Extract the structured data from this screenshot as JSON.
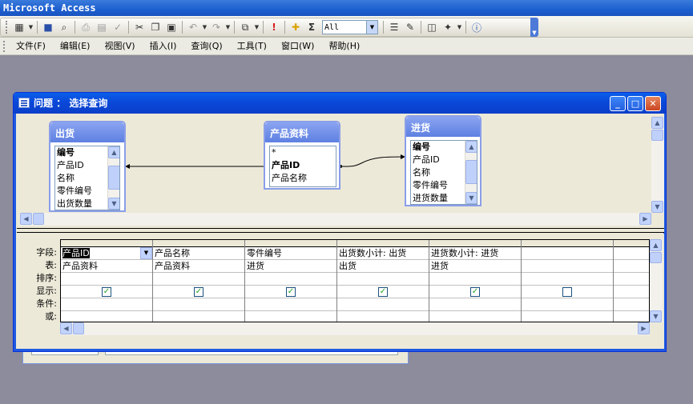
{
  "app": {
    "title": "Microsoft Access"
  },
  "toolbar": {
    "filter_value": "All",
    "icons": [
      "view-icon",
      "save-icon",
      "search-icon",
      "print-icon",
      "print-preview-icon",
      "spellcheck-icon",
      "cut-icon",
      "copy-icon",
      "paste-icon",
      "undo-icon",
      "redo-icon",
      "query-type-icon",
      "run-icon",
      "show-table-icon",
      "totals-icon",
      "properties-icon",
      "build-icon",
      "database-window-icon",
      "new-object-icon",
      "help-icon"
    ]
  },
  "menu": {
    "items": [
      "文件(F)",
      "编辑(E)",
      "视图(V)",
      "插入(I)",
      "查询(Q)",
      "工具(T)",
      "窗口(W)",
      "帮助(H)"
    ]
  },
  "query_window": {
    "title": "问题 ： 选择查询",
    "tables": [
      {
        "name": "出货",
        "fields": [
          "编号",
          "产品ID",
          "名称",
          "零件编号",
          "出货数量"
        ]
      },
      {
        "name": "产品资料",
        "fields": [
          "*",
          "产品ID",
          "产品名称"
        ]
      },
      {
        "name": "进货",
        "fields": [
          "编号",
          "产品ID",
          "名称",
          "零件编号",
          "进货数量"
        ]
      }
    ],
    "grid": {
      "row_labels": [
        "字段:",
        "表:",
        "排序:",
        "显示:",
        "条件:",
        "或:"
      ],
      "columns": [
        {
          "field": "产品ID",
          "table": "产品资料",
          "sort": "",
          "show": true
        },
        {
          "field": "产品名称",
          "table": "产品资料",
          "sort": "",
          "show": true
        },
        {
          "field": "零件编号",
          "table": "进货",
          "sort": "",
          "show": true
        },
        {
          "field": "出货数小计: 出货",
          "table": "出货",
          "sort": "",
          "show": true
        },
        {
          "field": "进货数小计: 进货",
          "table": "进货",
          "sort": "",
          "show": true
        },
        {
          "field": "",
          "table": "",
          "sort": "",
          "show": false
        },
        {
          "field": "",
          "table": "",
          "sort": "",
          "show": false
        }
      ]
    }
  }
}
